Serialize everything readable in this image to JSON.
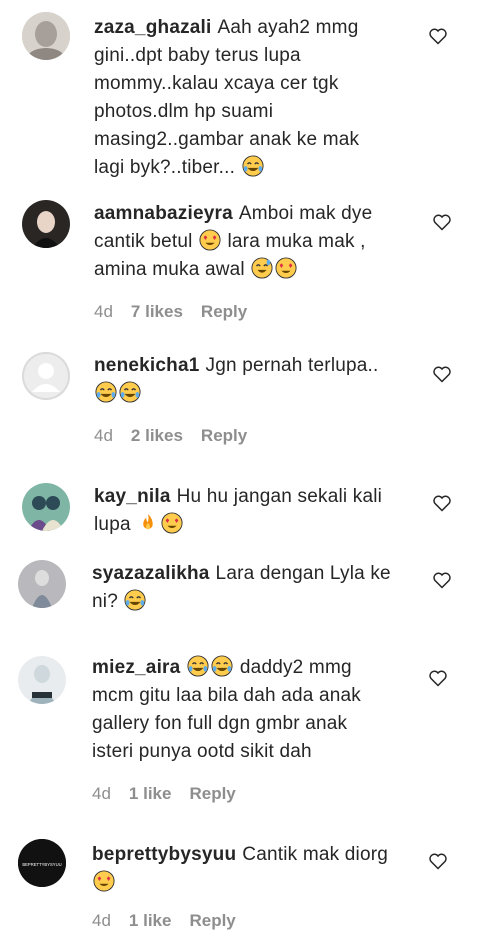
{
  "comments": [
    {
      "username": "zaza_ghazali",
      "text": "Aah ayah2 mmg gini..dpt baby terus lupa mommy..kalau xcaya cer tgk photos.dlm hp suami masing2..gambar anak ke mak lagi byk?..tiber...",
      "emojis": [
        "tears-of-joy"
      ]
    },
    {
      "username": "aamnabazieyra",
      "text": "Amboi mak dye cantik betul",
      "text2": "lara muka mak , amina muka awal",
      "time": "4d",
      "likes": "7 likes",
      "reply": "Reply"
    },
    {
      "username": "nenekicha1",
      "text": "Jgn pernah terlupa..",
      "time": "4d",
      "likes": "2 likes",
      "reply": "Reply"
    },
    {
      "username": "kay_nila",
      "text": "Hu hu jangan sekali kali lupa"
    },
    {
      "username": "syazazalikha",
      "text": "Lara dengan Lyla ke ni?"
    },
    {
      "username": "miez_aira",
      "text": "daddy2 mmg mcm gitu laa bila dah ada anak gallery fon full dgn gmbr anak isteri punya ootd sikit dah",
      "time": "4d",
      "likes": "1 like",
      "reply": "Reply"
    },
    {
      "username": "beprettybysyuu",
      "text": "Cantik mak diorg",
      "time": "4d",
      "likes": "1 like",
      "reply": "Reply"
    }
  ],
  "icons": {
    "heart": "heart-outline-icon"
  }
}
